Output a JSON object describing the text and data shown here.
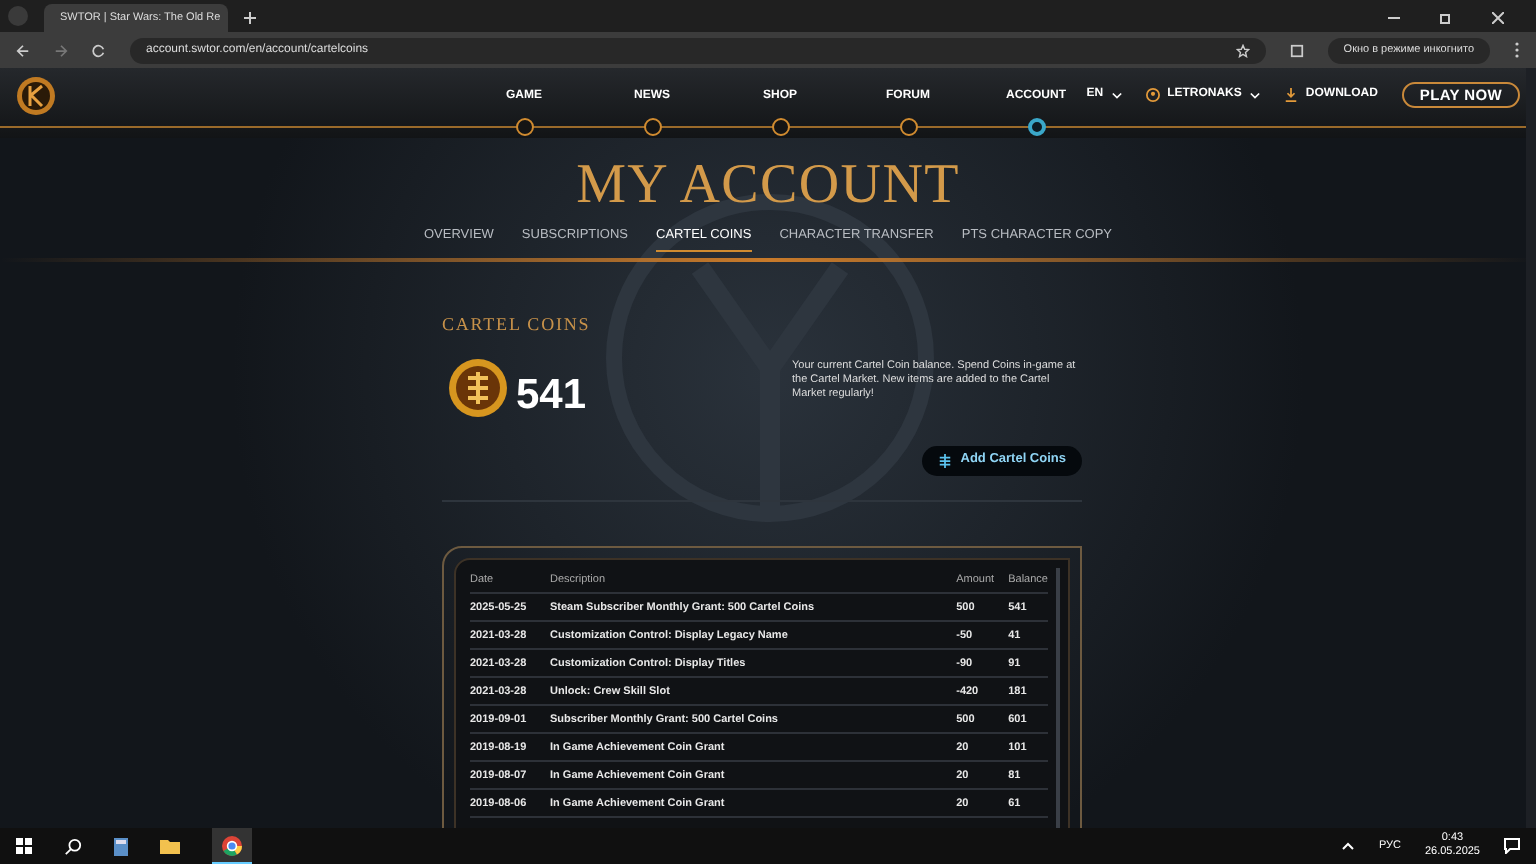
{
  "browser": {
    "tab_title": "SWTOR | Star Wars: The Old Re",
    "url": "account.swtor.com/en/account/cartelcoins",
    "incognito": "Окно в режиме инкогнито"
  },
  "site_nav": {
    "items": [
      {
        "label": "GAME",
        "selected": false
      },
      {
        "label": "NEWS",
        "selected": false
      },
      {
        "label": "SHOP",
        "selected": false
      },
      {
        "label": "FORUM",
        "selected": false
      },
      {
        "label": "ACCOUNT",
        "selected": true
      }
    ],
    "language": "EN",
    "user": "LETRONAKS",
    "download": "DOWNLOAD",
    "play": "PLAY NOW"
  },
  "page_title": "MY ACCOUNT",
  "sub_nav": [
    {
      "label": "OVERVIEW",
      "selected": false
    },
    {
      "label": "SUBSCRIPTIONS",
      "selected": false
    },
    {
      "label": "CARTEL COINS",
      "selected": true
    },
    {
      "label": "CHARACTER TRANSFER",
      "selected": false
    },
    {
      "label": "PTS CHARACTER COPY",
      "selected": false
    }
  ],
  "section_title": "CARTEL COINS",
  "balance": "541",
  "balance_note": "Your current Cartel Coin balance. Spend Coins in-game at the Cartel Market. New items are added to the Cartel Market regularly!",
  "add_button": "Add Cartel Coins",
  "table": {
    "columns": [
      "Date",
      "Description",
      "Amount",
      "Balance"
    ],
    "rows": [
      [
        "2025-05-25",
        "Steam Subscriber Monthly Grant: 500 Cartel Coins",
        "500",
        "541"
      ],
      [
        "2021-03-28",
        "Customization Control: Display Legacy Name",
        "-50",
        "41"
      ],
      [
        "2021-03-28",
        "Customization Control: Display Titles",
        "-90",
        "91"
      ],
      [
        "2021-03-28",
        "Unlock: Crew Skill Slot",
        "-420",
        "181"
      ],
      [
        "2019-09-01",
        "Subscriber Monthly Grant: 500 Cartel Coins",
        "500",
        "601"
      ],
      [
        "2019-08-19",
        "In Game Achievement Coin Grant",
        "20",
        "101"
      ],
      [
        "2019-08-07",
        "In Game Achievement Coin Grant",
        "20",
        "81"
      ],
      [
        "2019-08-06",
        "In Game Achievement Coin Grant",
        "20",
        "61"
      ]
    ]
  },
  "taskbar": {
    "language": "РУС",
    "time": "0:43",
    "date": "26.05.2025"
  }
}
